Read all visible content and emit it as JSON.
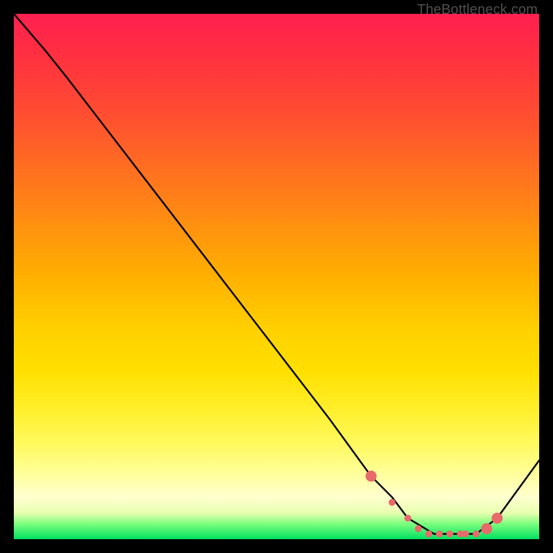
{
  "watermark": "TheBottleneck.com",
  "chart_data": {
    "type": "line",
    "title": "",
    "xlabel": "",
    "ylabel": "",
    "xlim": [
      0,
      100
    ],
    "ylim": [
      0,
      100
    ],
    "series": [
      {
        "name": "bottleneck-curve",
        "x": [
          0,
          6,
          10,
          20,
          30,
          40,
          50,
          60,
          68,
          72,
          75,
          80,
          85,
          88,
          92,
          100
        ],
        "values": [
          100,
          93,
          88,
          75,
          62,
          49,
          36,
          23,
          12,
          8,
          4,
          1,
          1,
          1,
          4,
          15
        ]
      }
    ],
    "markers": {
      "name": "optimal-zone-markers",
      "x": [
        68,
        72,
        75,
        77,
        79,
        81,
        83,
        85,
        86,
        88,
        90,
        92
      ],
      "values": [
        12,
        7,
        4,
        2,
        1,
        1,
        1,
        1,
        1,
        1,
        2,
        4
      ],
      "color": "#e86a6a",
      "size_small": 5,
      "size_large": 8
    },
    "gradient_stops": [
      {
        "pos": 0,
        "color": "#ff2050"
      },
      {
        "pos": 50,
        "color": "#ffd000"
      },
      {
        "pos": 95,
        "color": "#ffffd0"
      },
      {
        "pos": 100,
        "color": "#00e060"
      }
    ]
  }
}
